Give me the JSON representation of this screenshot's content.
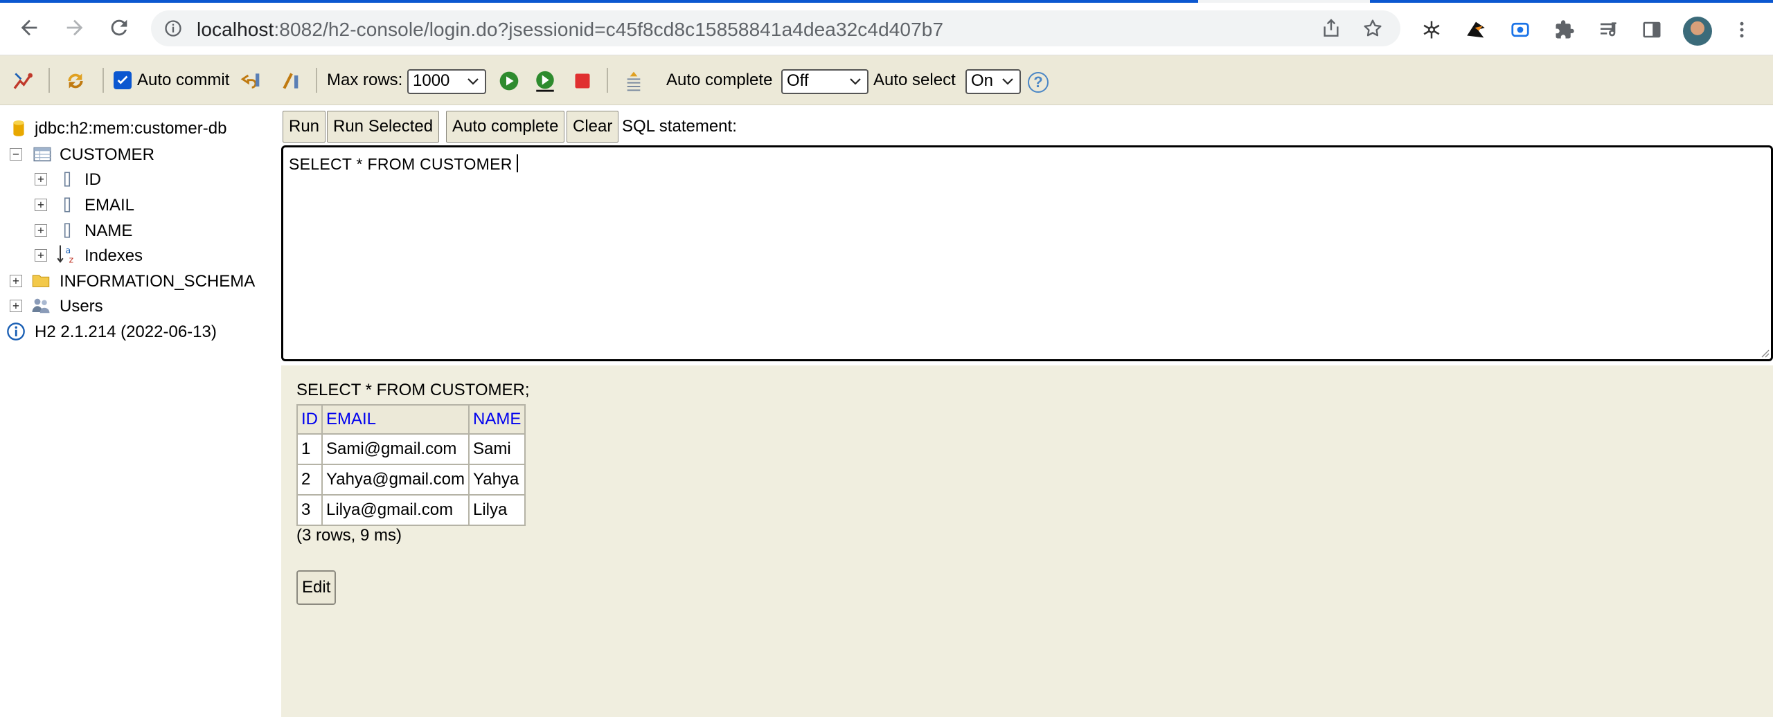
{
  "browser": {
    "url_host": "localhost",
    "url_rest": ":8082/h2-console/login.do?jsessionid=c45f8cd8c15858841a4dea32c4d407b7",
    "icons": [
      "back-icon",
      "forward-icon",
      "reload-icon",
      "site-info-icon",
      "share-icon",
      "bookmark-star-icon",
      "snowflake-extension-icon",
      "bird-extension-icon",
      "record-extension-icon",
      "extensions-puzzle-icon",
      "reading-list-icon",
      "side-panel-icon",
      "profile-avatar",
      "menu-kebab-icon"
    ],
    "accent": "#0b57d0"
  },
  "toolbar": {
    "auto_commit_label": "Auto commit",
    "auto_commit_checked": true,
    "max_rows_label": "Max rows:",
    "max_rows_value": "1000",
    "auto_complete_label": "Auto complete",
    "auto_complete_value": "Off",
    "auto_select_label": "Auto select",
    "auto_select_value": "On",
    "help_label": "?"
  },
  "tree": {
    "connection": "jdbc:h2:mem:customer-db",
    "table": "CUSTOMER",
    "columns": [
      "ID",
      "EMAIL",
      "NAME"
    ],
    "indexes": "Indexes",
    "schema": "INFORMATION_SCHEMA",
    "users": "Users",
    "version": "H2 2.1.214 (2022-06-13)"
  },
  "query": {
    "run": "Run",
    "run_selected": "Run Selected",
    "auto_complete": "Auto complete",
    "clear": "Clear",
    "sql_label": "SQL statement:",
    "sql_text": "SELECT * FROM CUSTOMER"
  },
  "results": {
    "sql": "SELECT * FROM CUSTOMER;",
    "headers": [
      "ID",
      "EMAIL",
      "NAME"
    ],
    "rows": [
      [
        "1",
        "Sami@gmail.com",
        "Sami"
      ],
      [
        "2",
        "Yahya@gmail.com",
        "Yahya"
      ],
      [
        "3",
        "Lilya@gmail.com",
        "Lilya"
      ]
    ],
    "count": "(3 rows, 9 ms)",
    "edit": "Edit"
  }
}
